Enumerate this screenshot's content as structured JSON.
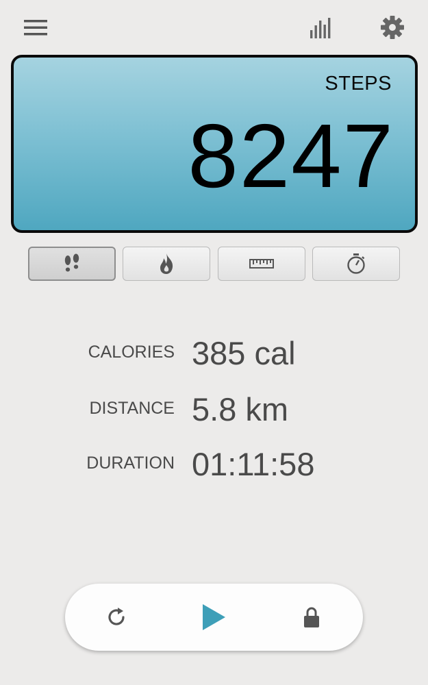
{
  "header": {
    "menu_icon": "hamburger-menu-icon",
    "stats_icon": "bar-chart-icon",
    "settings_icon": "gear-icon"
  },
  "steps": {
    "label": "STEPS",
    "value": "8247"
  },
  "tabs": [
    {
      "name": "steps",
      "icon": "footprints-icon",
      "active": true
    },
    {
      "name": "calories",
      "icon": "flame-icon",
      "active": false
    },
    {
      "name": "distance",
      "icon": "ruler-icon",
      "active": false
    },
    {
      "name": "duration",
      "icon": "stopwatch-icon",
      "active": false
    }
  ],
  "stats": {
    "calories": {
      "label": "CALORIES",
      "value": "385 cal"
    },
    "distance": {
      "label": "DISTANCE",
      "value": "5.8 km"
    },
    "duration": {
      "label": "DURATION",
      "value": "01:11:58"
    }
  },
  "controls": {
    "reset_icon": "reset-icon",
    "play_icon": "play-icon",
    "lock_icon": "lock-icon"
  },
  "colors": {
    "panel_top": "#a5d3e0",
    "panel_bottom": "#4fa7c0",
    "play_accent": "#3e9fb8",
    "text": "#4a4a4a",
    "background": "#ecebea"
  }
}
